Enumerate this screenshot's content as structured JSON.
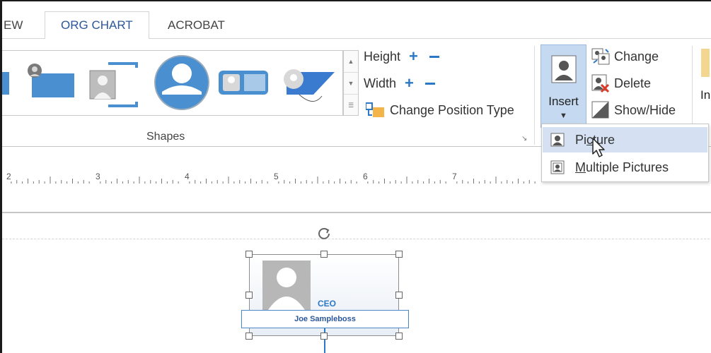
{
  "tabs": [
    {
      "label": "EW"
    },
    {
      "label": "ORG CHART"
    },
    {
      "label": "ACROBAT"
    }
  ],
  "ribbon": {
    "size": {
      "height_label": "Height",
      "width_label": "Width",
      "change_position_label": "Change Position Type"
    },
    "shapes_group_label": "Shapes",
    "insert_button_label": "Insert",
    "picture_commands": {
      "change_label": "Change",
      "delete_label": "Delete",
      "show_hide_label": "Show/Hide"
    },
    "cut_off_label": "In"
  },
  "insert_menu": {
    "items": [
      {
        "label": "Picture",
        "underline_char": "c"
      },
      {
        "label": "Multiple Pictures",
        "underline_char": "M"
      }
    ]
  },
  "ruler": {
    "numbers": [
      "2",
      "3",
      "4",
      "5",
      "6",
      "7"
    ]
  },
  "org_node": {
    "title": "CEO",
    "name": "Joe Sampleboss"
  },
  "colors": {
    "accent": "#2b79c6",
    "tab_active_text": "#2b579a",
    "insert_highlight": "#c5d9f0",
    "menu_hover": "#d5e1f2"
  }
}
